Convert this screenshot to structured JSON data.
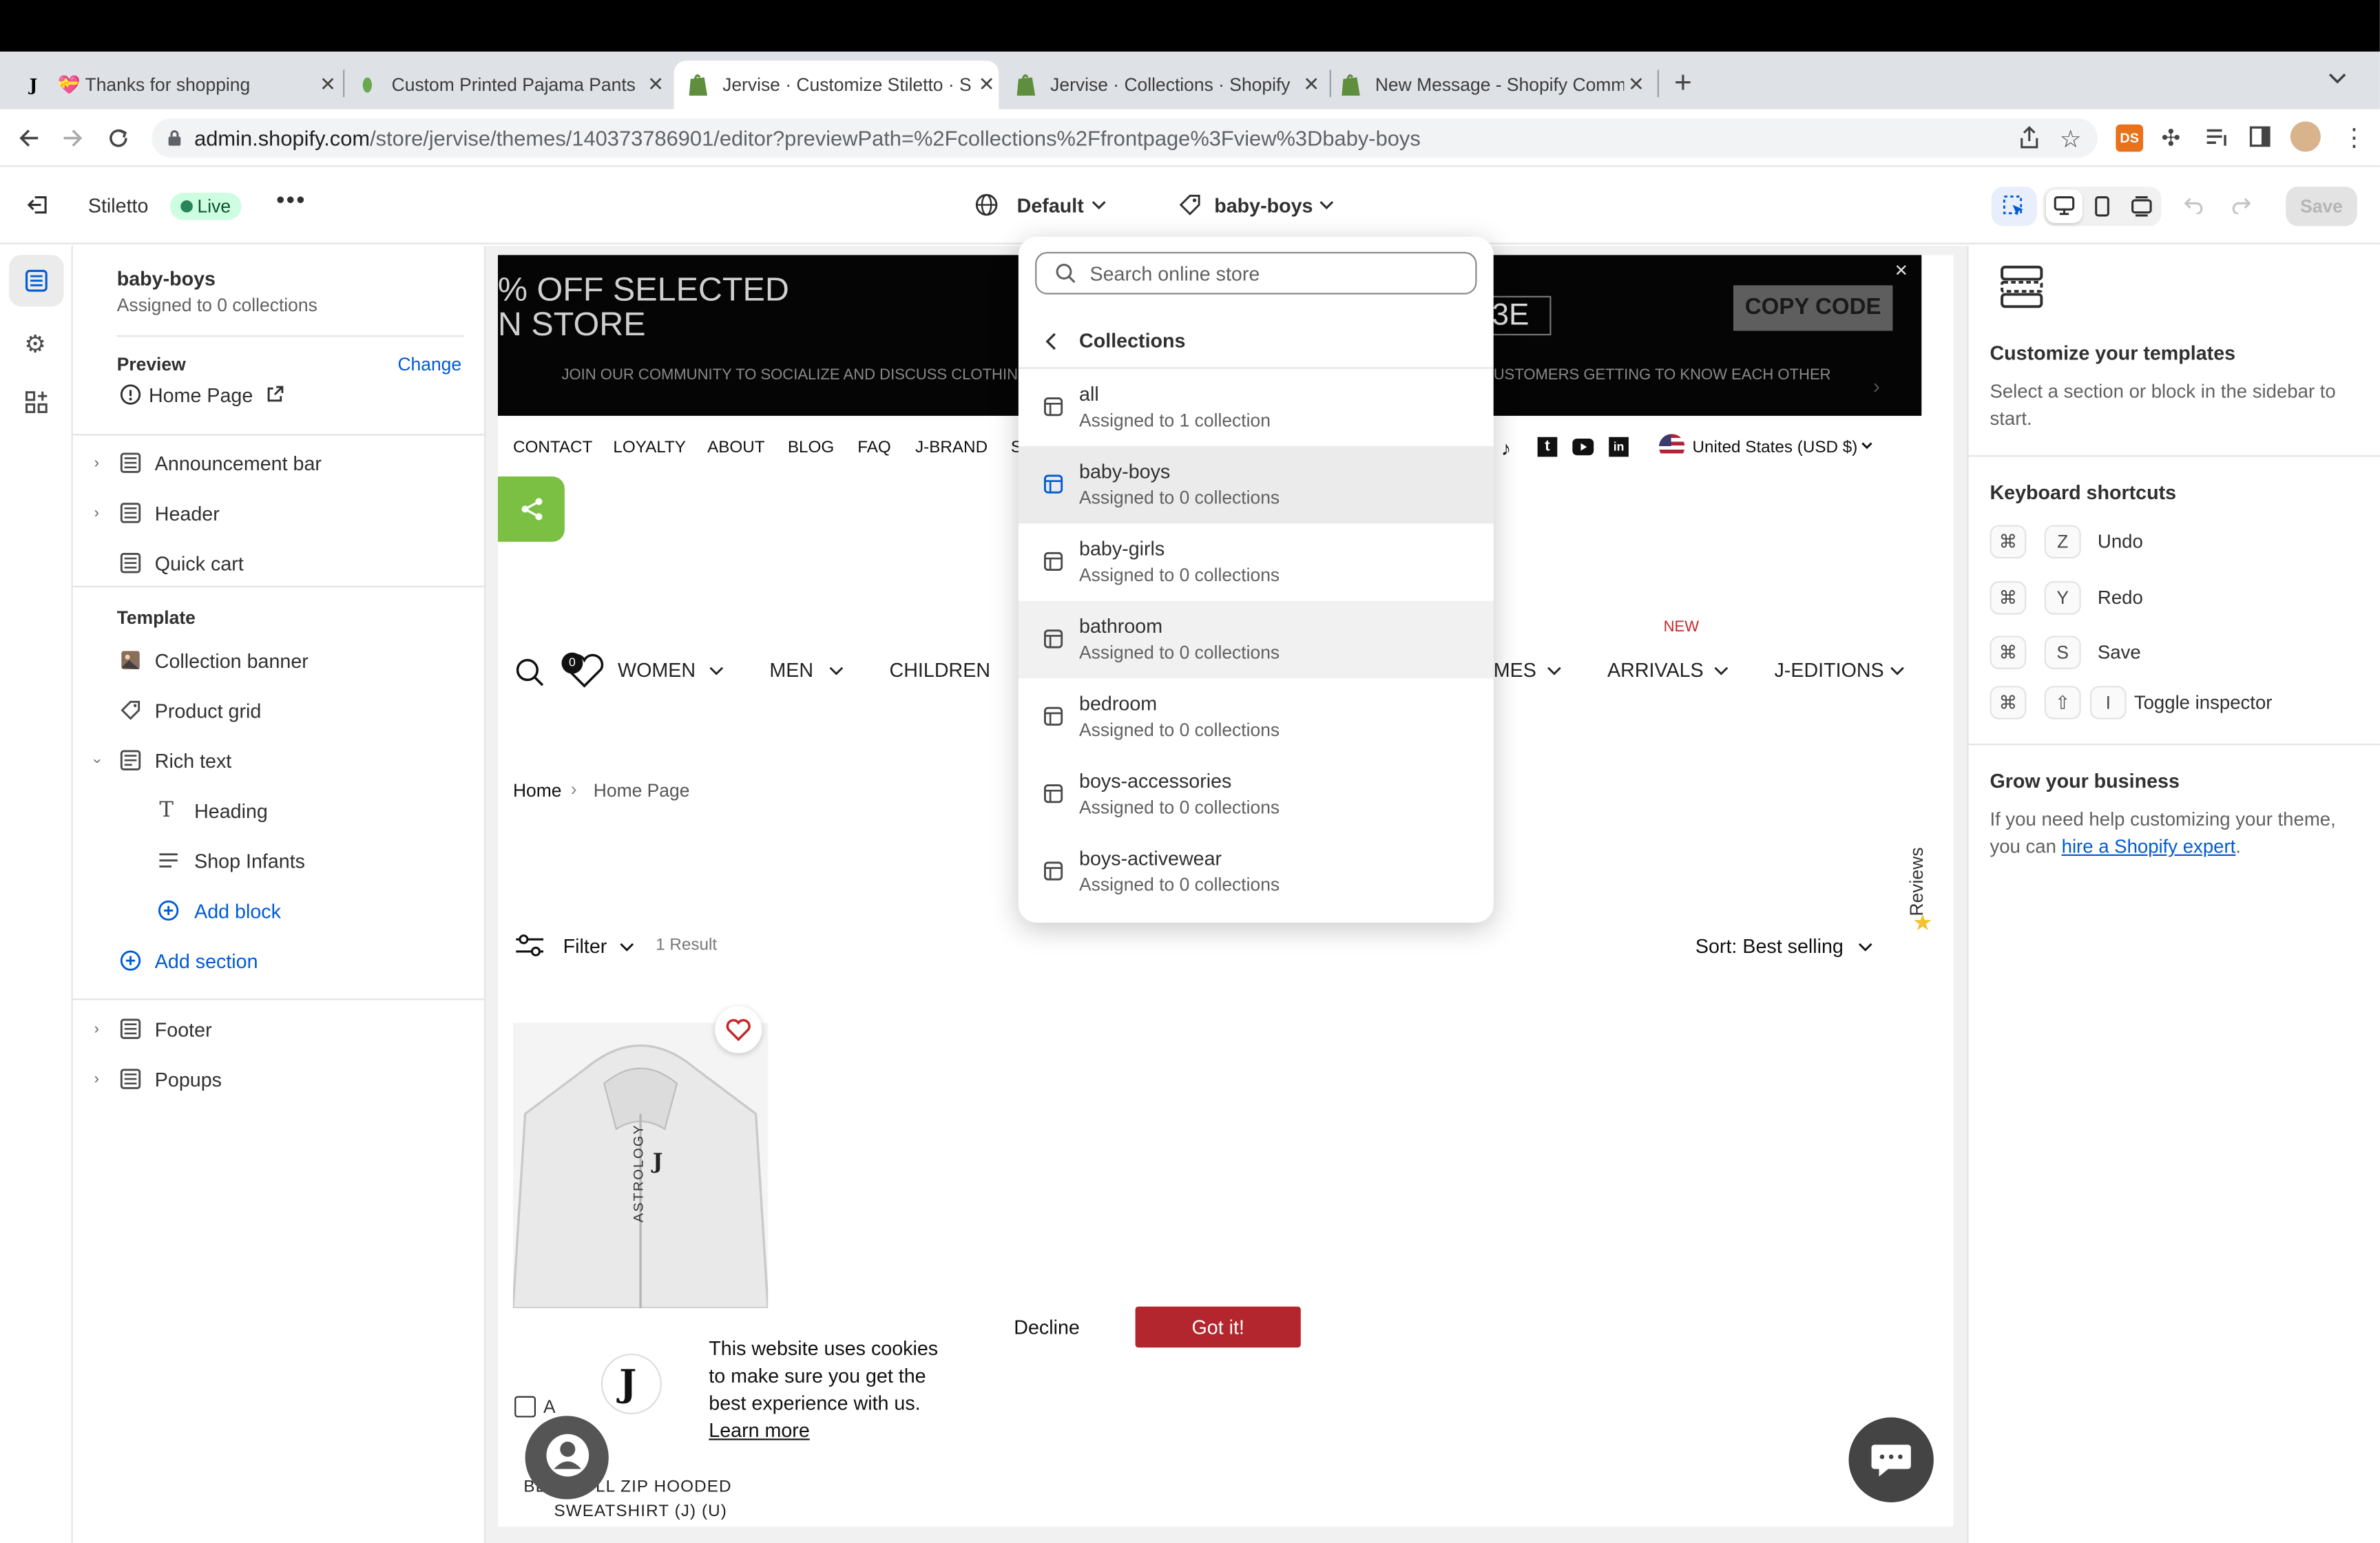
{
  "browser": {
    "tabs": [
      {
        "title": "💝 Thanks for shopping",
        "favicon": "J"
      },
      {
        "title": "Custom Printed Pajama Pants",
        "favicon": "leaf"
      },
      {
        "title": "Jervise · Customize Stiletto · S",
        "favicon": "shopify"
      },
      {
        "title": "Jervise · Collections · Shopify",
        "favicon": "shopify"
      },
      {
        "title": "New Message - Shopify Comm",
        "favicon": "shopify"
      }
    ],
    "url_host": "admin.shopify.com",
    "url_path": "/store/jervise/themes/140373786901/editor?previewPath=%2Fcollections%2Ffrontpage%3Fview%3Dbaby-boys"
  },
  "editor": {
    "theme_name": "Stiletto",
    "live_badge": "Live",
    "locale_label": "Default",
    "template_label": "baby-boys",
    "save_label": "Save"
  },
  "sidebar": {
    "title": "baby-boys",
    "subtitle": "Assigned to 0 collections",
    "preview_label": "Preview",
    "change_label": "Change",
    "preview_page": "Home Page",
    "header_items": [
      {
        "label": "Announcement bar"
      },
      {
        "label": "Header"
      },
      {
        "label": "Quick cart"
      }
    ],
    "template_label": "Template",
    "template_items": [
      {
        "label": "Collection banner"
      },
      {
        "label": "Product grid"
      },
      {
        "label": "Rich text"
      }
    ],
    "rich_text_blocks": [
      {
        "label": "Heading"
      },
      {
        "label": "Shop Infants"
      }
    ],
    "add_block": "Add block",
    "add_section": "Add section",
    "footer_items": [
      {
        "label": "Footer"
      },
      {
        "label": "Popups"
      }
    ]
  },
  "dropdown": {
    "search_placeholder": "Search online store",
    "back_label": "Collections",
    "items": [
      {
        "title": "all",
        "sub": "Assigned to 1 collection"
      },
      {
        "title": "baby-boys",
        "sub": "Assigned to 0 collections"
      },
      {
        "title": "baby-girls",
        "sub": "Assigned to 0 collections"
      },
      {
        "title": "bathroom",
        "sub": "Assigned to 0 collections"
      },
      {
        "title": "bedroom",
        "sub": "Assigned to 0 collections"
      },
      {
        "title": "boys-accessories",
        "sub": "Assigned to 0 collections"
      },
      {
        "title": "boys-activewear",
        "sub": "Assigned to 0 collections"
      }
    ]
  },
  "preview": {
    "promo_line1": "% OFF SELECTED",
    "promo_line2": "N STORE",
    "promo_code_fragment": "3E",
    "copy_code": "COPY CODE",
    "community_left": "JOIN OUR COMMUNITY TO SOCIALIZE AND DISCUSS CLOTHIN",
    "community_right": "USTOMERS GETTING TO KNOW EACH OTHER",
    "top_nav": [
      "CONTACT",
      "LOYALTY",
      "ABOUT",
      "BLOG",
      "FAQ",
      "J-BRAND",
      "S"
    ],
    "country": "United States (USD $)",
    "wishlist_count": "0",
    "main_nav": [
      "WOMEN",
      "MEN",
      "CHILDREN",
      "MES",
      "ARRIVALS",
      "J-EDITIONS"
    ],
    "new_badge": "NEW",
    "breadcrumb_home": "Home",
    "breadcrumb_current": "Home Page",
    "filter_label": "Filter",
    "result_count": "1 Result",
    "sort_label": "Sort: Best selling",
    "reviews_label": "Reviews",
    "product_title_line1": "BL     FULL ZIP HOODED",
    "product_title_line2": "SWEATSHIRT (J) (U)",
    "product_print": "ASTROLOGY",
    "compare_label": "A",
    "cookie_text_1": "This website uses cookies",
    "cookie_text_2": "to make sure you get the",
    "cookie_text_3": "best experience with us.",
    "cookie_learn": "Learn more",
    "cookie_decline": "Decline",
    "cookie_accept": "Got it!"
  },
  "right_panel": {
    "title": "Customize your templates",
    "desc": "Select a section or block in the sidebar to start.",
    "shortcuts_title": "Keyboard shortcuts",
    "shortcuts": [
      {
        "keys": [
          "⌘",
          "Z"
        ],
        "label": "Undo"
      },
      {
        "keys": [
          "⌘",
          "Y"
        ],
        "label": "Redo"
      },
      {
        "keys": [
          "⌘",
          "S"
        ],
        "label": "Save"
      },
      {
        "keys": [
          "⌘",
          "⇧",
          "I"
        ],
        "label": "Toggle inspector"
      }
    ],
    "grow_title": "Grow your business",
    "grow_text": "If you need help customizing your theme, you can",
    "grow_link": "hire a Shopify expert",
    "grow_end": "."
  },
  "colors": {
    "accent": "#005bd3",
    "live_green": "#29845a",
    "cookie_red": "#b3262d",
    "share_green": "#7bc043",
    "chrome_tab_bar": "#dee1e6"
  }
}
